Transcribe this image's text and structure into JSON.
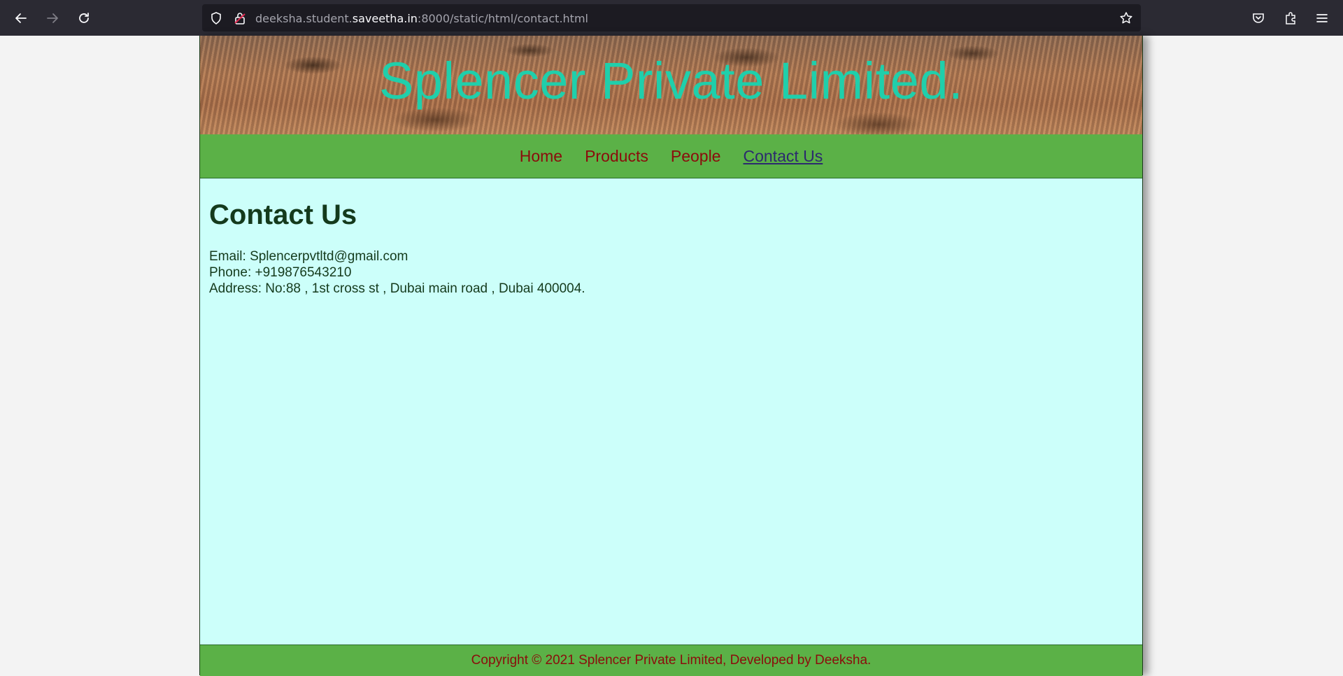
{
  "browser": {
    "url_prefix": "deeksha.student.",
    "url_host": "saveetha.in",
    "url_suffix": ":8000/static/html/contact.html"
  },
  "site": {
    "title": "Splencer Private Limited.",
    "nav": [
      {
        "label": "Home"
      },
      {
        "label": "Products"
      },
      {
        "label": "People"
      },
      {
        "label": "Contact Us",
        "active": true
      }
    ]
  },
  "contact": {
    "heading": "Contact Us",
    "email": "Email: Splencerpvtltd@gmail.com",
    "phone": "Phone: +919876543210",
    "address": "Address: No:88 , 1st cross st , Dubai main road , Dubai 400004."
  },
  "footer": {
    "text": "Copyright © 2021 Splencer Private Limited, Developed by Deeksha."
  },
  "colors": {
    "title": "#1fcfab",
    "nav_bg": "#5bb147",
    "nav_link": "#8b0c0c",
    "content_bg": "#ccfffa",
    "heading": "#143a1c"
  }
}
